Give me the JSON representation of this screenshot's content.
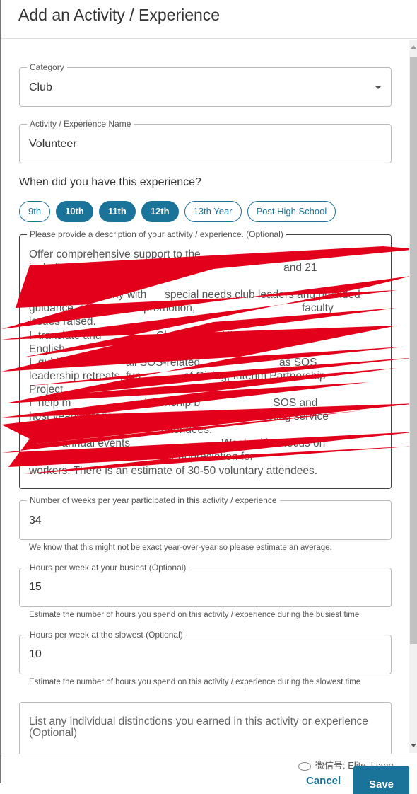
{
  "title": "Add an Activity / Experience",
  "category": {
    "label": "Category",
    "value": "Club"
  },
  "name": {
    "label": "Activity / Experience Name",
    "value": "Volunteer"
  },
  "grades": {
    "question": "When did you have this experience?",
    "options": [
      {
        "label": "9th",
        "selected": false
      },
      {
        "label": "10th",
        "selected": true
      },
      {
        "label": "11th",
        "selected": true
      },
      {
        "label": "12th",
        "selected": true
      },
      {
        "label": "13th Year",
        "selected": false
      },
      {
        "label": "Post High School",
        "selected": false
      }
    ]
  },
  "description": {
    "label": "Please provide a description of your activity / experience. (Optional)",
    "lines": [
      "Offer comprehensive support to the",
      "including 6 individual clubs                                         and 21",
      "service club with",
      "I  check in quarterly with      special needs club leaders and provided",
      "guidance, support,        promotion,                                   faculty",
      "issues raised.",
      "I  translate and                  Chuen Long, UKIC and bilingual",
      "English",
      "I  guide                    all SOS-related                          as SOS",
      "leadership retreats, fun              of Giving, Interim Partnership",
      "Project",
      "I  help m                     relationship b                        SOS and",
      "host yearly dragon                                       connecting service",
      "with                                     attendees.",
      "I  lead annual events                              Week with a focus on",
      "creating art crafts               our appreciation for",
      "workers. There is an estimate of 30-50 voluntary attendees."
    ],
    "redaction_color": "#e2001a"
  },
  "weeks": {
    "label": "Number of weeks per year participated in this activity / experience",
    "value": "34",
    "help": "We know that this might not be exact year-over-year so please estimate an average."
  },
  "busiest": {
    "label": "Hours per week at your busiest (Optional)",
    "value": "15",
    "help": "Estimate the number of hours you spend on this activity / experience during the busiest time"
  },
  "slowest": {
    "label": "Hours per week at the slowest (Optional)",
    "value": "10",
    "help": "Estimate the number of hours you spend on this activity / experience during the slowest time"
  },
  "distinctions": {
    "placeholder": "List any individual distinctions you earned in this activity or experience (Optional)"
  },
  "footer": {
    "cancel": "Cancel",
    "save": "Save",
    "watermark": "微信号: Elite_Liang"
  },
  "accent": "#1a7398"
}
